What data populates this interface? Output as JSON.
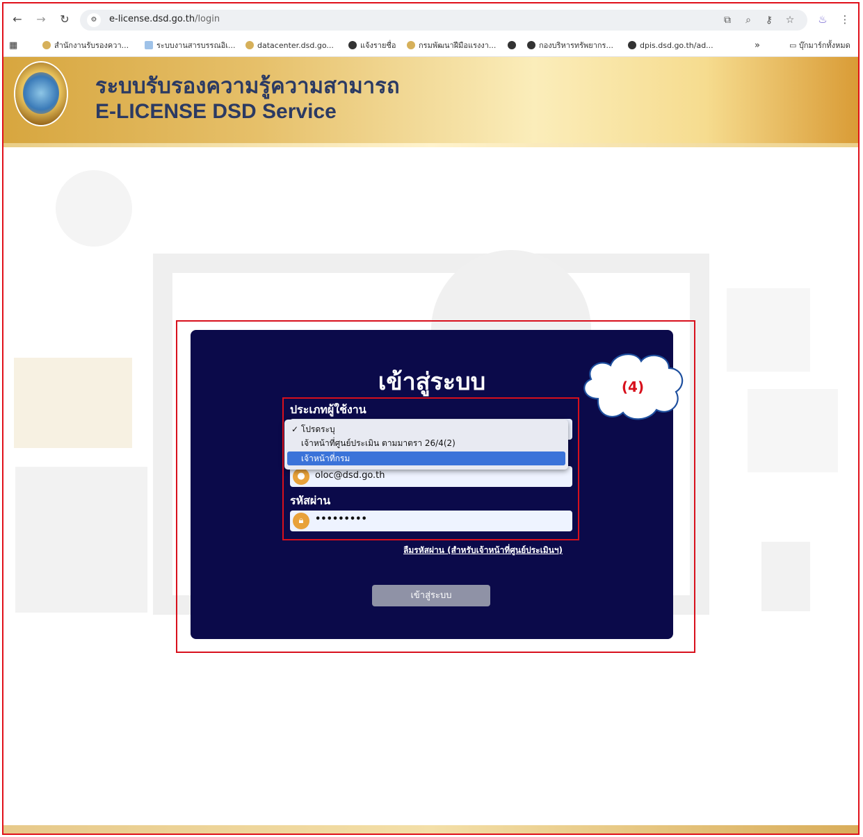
{
  "browser": {
    "url_host": "e-license.dsd.go.th",
    "url_path": "/login",
    "bookmarks": [
      {
        "label": "สำนักงานรับรองควา...",
        "icon": "seal-icon"
      },
      {
        "label": "ระบบงานสารบรรณอิเ...",
        "icon": "document-icon"
      },
      {
        "label": "datacenter.dsd.go...",
        "icon": "seal-icon"
      },
      {
        "label": "แจ้งรายชื่อ",
        "icon": "globe-icon"
      },
      {
        "label": "กรมพัฒนาฝีมือแรงงา...",
        "icon": "seal-icon"
      },
      {
        "label": "",
        "icon": "globe-icon"
      },
      {
        "label": "กองบริหารทรัพยากร...",
        "icon": "globe-icon"
      },
      {
        "label": "dpis.dsd.go.th/ad...",
        "icon": "globe-icon"
      }
    ],
    "more_bookmarks": "»",
    "all_bookmarks": "บุ๊กมาร์กทั้งหมด"
  },
  "site": {
    "title_th": "ระบบรับรองความรู้ความสามารถ",
    "title_en": "E-LICENSE DSD Service"
  },
  "login": {
    "title": "เข้าสู่ระบบ",
    "user_type_label": "ประเภทผู้ใช้งาน",
    "user_type_options": [
      {
        "label": "✓ โปรดระบุ",
        "selected": false
      },
      {
        "label": "เจ้าหน้าที่ศูนย์ประเมิน ตามมาตรา 26/4(2)",
        "selected": false
      },
      {
        "label": "เจ้าหน้าที่กรม",
        "selected": true
      }
    ],
    "username_value": "oloc@dsd.go.th",
    "password_label": "รหัสผ่าน",
    "password_value": "•••••••••",
    "forgot_link": "ลืมรหัสผ่าน (สำหรับเจ้าหน้าที่ศูนย์ประเมินฯ)",
    "submit_label": "เข้าสู่ระบบ"
  },
  "annotation": {
    "callout": "(4)",
    "color": "#d8101c"
  },
  "colors": {
    "card_bg": "#0b0a4a",
    "selected_option": "#3b73d9",
    "header_title": "#2b3a63"
  }
}
